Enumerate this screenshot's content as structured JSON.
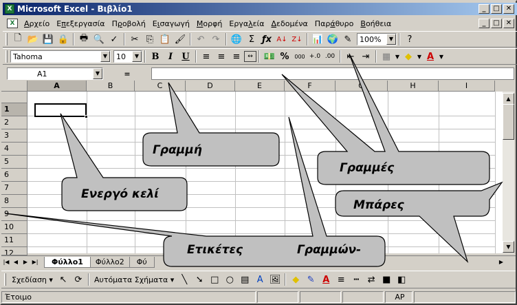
{
  "titlebar": {
    "title": "Microsoft Excel - Βιβλίο1",
    "app_icon": "excel-icon"
  },
  "window_controls": {
    "minimize": "_",
    "maximize": "□",
    "close": "✕"
  },
  "menu": {
    "items": [
      {
        "pre": "",
        "ul": "Α",
        "post": "ρχείο"
      },
      {
        "pre": "Ε",
        "ul": "π",
        "post": "εξεργασία"
      },
      {
        "pre": "Π",
        "ul": "ρ",
        "post": "οβολή"
      },
      {
        "pre": "Ε",
        "ul": "ι",
        "post": "σαγωγή"
      },
      {
        "pre": "",
        "ul": "Μ",
        "post": "ορφή"
      },
      {
        "pre": "Εργα",
        "ul": "λ",
        "post": "εία"
      },
      {
        "pre": "",
        "ul": "Δ",
        "post": "εδομένα"
      },
      {
        "pre": "Παρ",
        "ul": "ά",
        "post": "θυρο"
      },
      {
        "pre": "",
        "ul": "Β",
        "post": "οήθεια"
      }
    ]
  },
  "toolbar_standard": {
    "zoom": "100%"
  },
  "toolbar_format": {
    "font": "Tahoma",
    "size": "10",
    "bold": "B",
    "italic": "I",
    "underline": "U",
    "percent": "%",
    "thousands": "000"
  },
  "formula_bar": {
    "name_box": "A1",
    "equals": "=",
    "content": ""
  },
  "columns": [
    "A",
    "B",
    "C",
    "D",
    "E",
    "F",
    "G",
    "H",
    "I"
  ],
  "rows": [
    "1",
    "2",
    "3",
    "4",
    "5",
    "6",
    "7",
    "8",
    "9",
    "10",
    "11",
    "12"
  ],
  "sheets": [
    {
      "name": "Φύλλο1",
      "active": true
    },
    {
      "name": "Φύλλο2",
      "active": false
    },
    {
      "name": "Φύ",
      "active": false
    }
  ],
  "drawing_toolbar": {
    "draw": "Σχεδίαση",
    "autoshapes": "Αυτόματα Σχήματα"
  },
  "statusbar": {
    "ready": "Έτοιμο",
    "mode": "ΑΡ"
  },
  "callouts": {
    "active_cell": "Ενεργό κελί",
    "row": "Γραμμή",
    "rows": "Γραμμές",
    "bars": "Μπάρες",
    "labels": "Ετικέτες",
    "rows_dash": "Γραμμών-"
  }
}
